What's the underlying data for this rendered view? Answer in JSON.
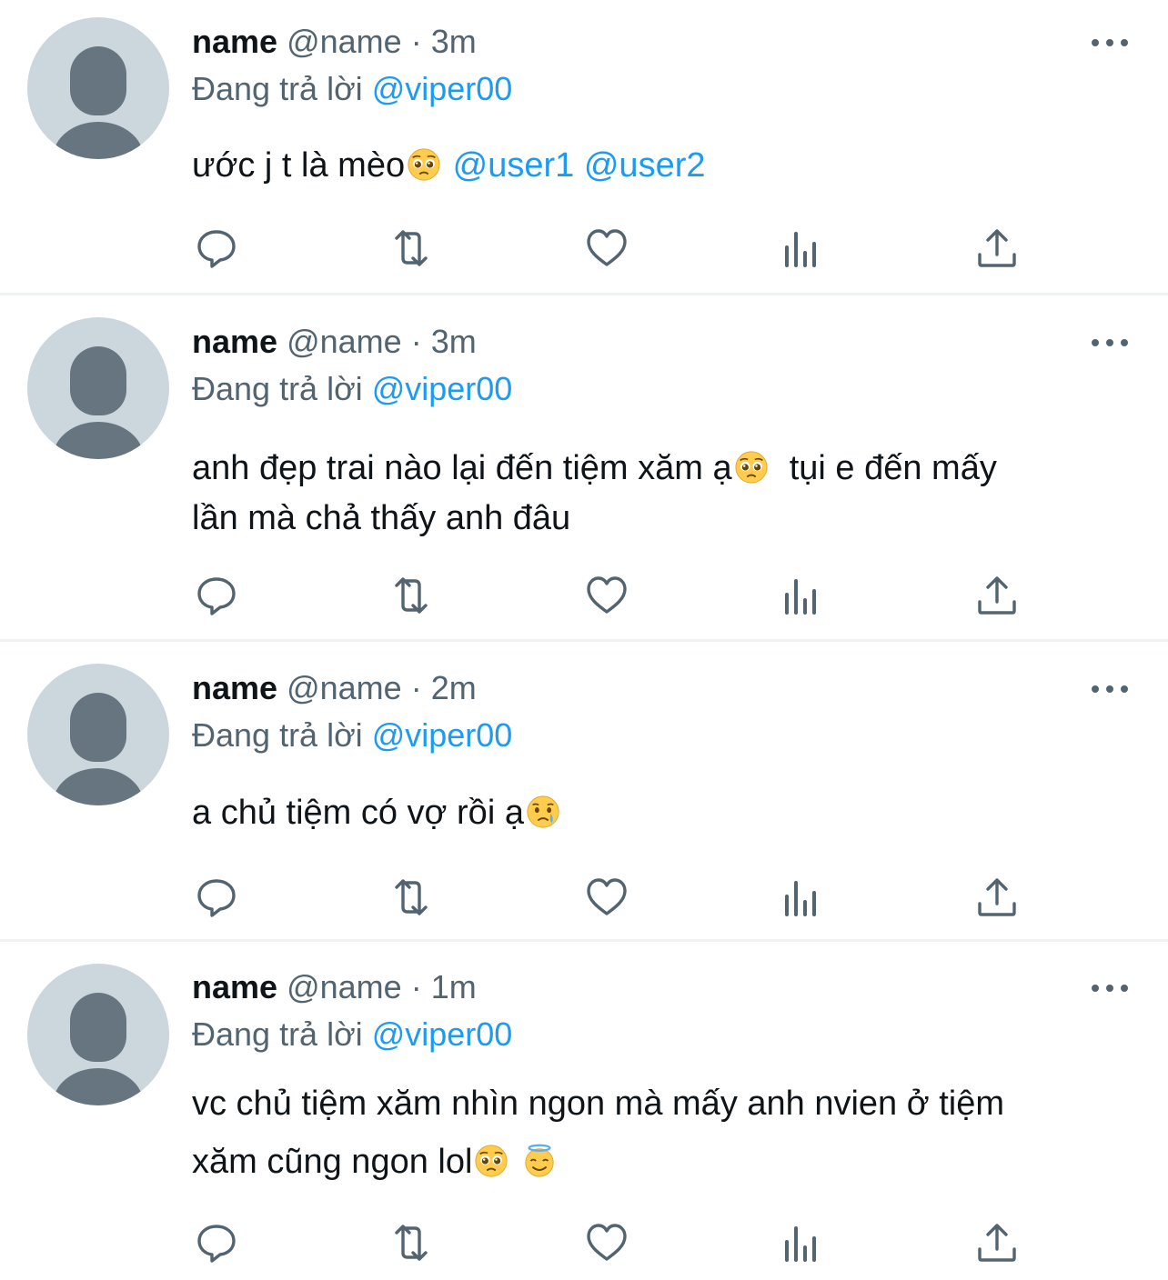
{
  "tweets": [
    {
      "name": "name",
      "handle": "@name",
      "separator": "·",
      "time": "3m",
      "reply_prefix": "Đang trả lời",
      "reply_to": "@viper00",
      "text_parts": [
        "ước j t là mèo",
        "@user1",
        "@user2"
      ],
      "emojis": [
        "pleading-face"
      ]
    },
    {
      "name": "name",
      "handle": "@name",
      "separator": "·",
      "time": "3m",
      "reply_prefix": "Đang trả lời",
      "reply_to": "@viper00",
      "text_parts": [
        "anh đẹp trai nào lại đến tiệm xăm ạ",
        "tụi e đến mấy",
        "lần mà chả thấy anh đâu"
      ],
      "emojis": [
        "pleading-face"
      ]
    },
    {
      "name": "name",
      "handle": "@name",
      "separator": "·",
      "time": "2m",
      "reply_prefix": "Đang trả lời",
      "reply_to": "@viper00",
      "text_parts": [
        "a chủ tiệm có vợ rồi ạ"
      ],
      "emojis": [
        "sad-but-relieved-face"
      ]
    },
    {
      "name": "name",
      "handle": "@name",
      "separator": "·",
      "time": "1m",
      "reply_prefix": "Đang trả lời",
      "reply_to": "@viper00",
      "text_parts": [
        "vc chủ tiệm xăm nhìn ngon mà mấy anh nvien ở tiệm",
        "xăm cũng ngon lol"
      ],
      "emojis": [
        "pleading-face",
        "smiling-face-with-halo"
      ]
    }
  ],
  "actions": [
    "reply-icon",
    "retweet-icon",
    "like-icon",
    "views-icon",
    "share-icon"
  ],
  "colors": {
    "text": "#0f1419",
    "secondary": "#536471",
    "link": "#1d9bf0",
    "avatar_bg": "#ccd6dd",
    "avatar_fg": "#66757f",
    "divider": "#eff3f4"
  }
}
